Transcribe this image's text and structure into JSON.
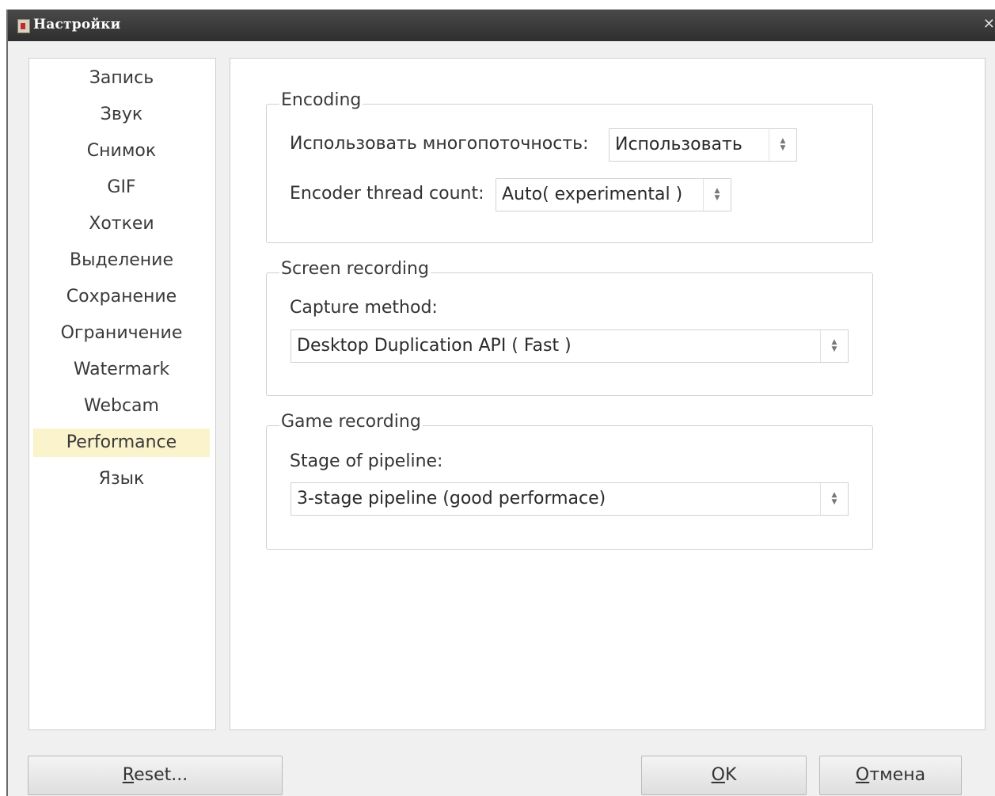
{
  "window": {
    "title": "Настройки",
    "close_glyph": "✕"
  },
  "sidebar": {
    "items": [
      {
        "label": "Запись"
      },
      {
        "label": "Звук"
      },
      {
        "label": "Снимок"
      },
      {
        "label": "GIF"
      },
      {
        "label": "Хоткеи"
      },
      {
        "label": "Выделение"
      },
      {
        "label": "Сохранение"
      },
      {
        "label": "Ограничение"
      },
      {
        "label": "Watermark"
      },
      {
        "label": "Webcam"
      },
      {
        "label": "Performance",
        "active": true
      },
      {
        "label": "Язык"
      }
    ],
    "active_color": "#fbf3cc"
  },
  "encoding": {
    "title": "Encoding",
    "multithread_label": "Использовать многопоточность:",
    "multithread_value": "Использовать",
    "thread_count_label": "Encoder thread count:",
    "thread_count_value": "Auto( experimental )"
  },
  "screen_recording": {
    "title": "Screen recording",
    "capture_label": "Capture method:",
    "capture_value": "Desktop Duplication API ( Fast )"
  },
  "game_recording": {
    "title": "Game recording",
    "pipeline_label": "Stage of pipeline:",
    "pipeline_value": "3-stage pipeline (good performace)"
  },
  "buttons": {
    "reset_first": "R",
    "reset_rest": "eset...",
    "ok_first": "O",
    "ok_rest": "K",
    "cancel_first": "О",
    "cancel_rest": "тмена"
  },
  "icons": {
    "spin": "spin-arrows-icon",
    "app": "app-icon",
    "close": "close-icon"
  }
}
